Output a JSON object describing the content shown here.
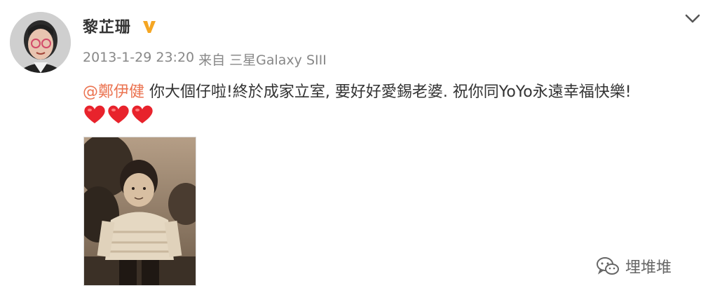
{
  "user": {
    "name": "黎芷珊",
    "verified_icon": "verified-v-icon",
    "avatar_icon": "user-avatar"
  },
  "meta": {
    "timestamp": "2013-1-29 23:20",
    "source_prefix": "来自",
    "source_device": "三星Galaxy SIII"
  },
  "post": {
    "mention": "@鄭伊健",
    "text": " 你大個仔啦!終於成家立室, 要好好愛錫老婆. 祝你同YoYo永遠幸福快樂!",
    "hearts_count": 3,
    "heart_icon": "red-heart-icon"
  },
  "colors": {
    "mention": "#eb7350",
    "verified": "#f5a623",
    "heart": "#e8232c",
    "meta": "#888888",
    "text": "#333333"
  },
  "watermark": {
    "text": "埋堆堆",
    "icon": "wechat-icon"
  },
  "menu": {
    "icon": "chevron-down-icon"
  }
}
